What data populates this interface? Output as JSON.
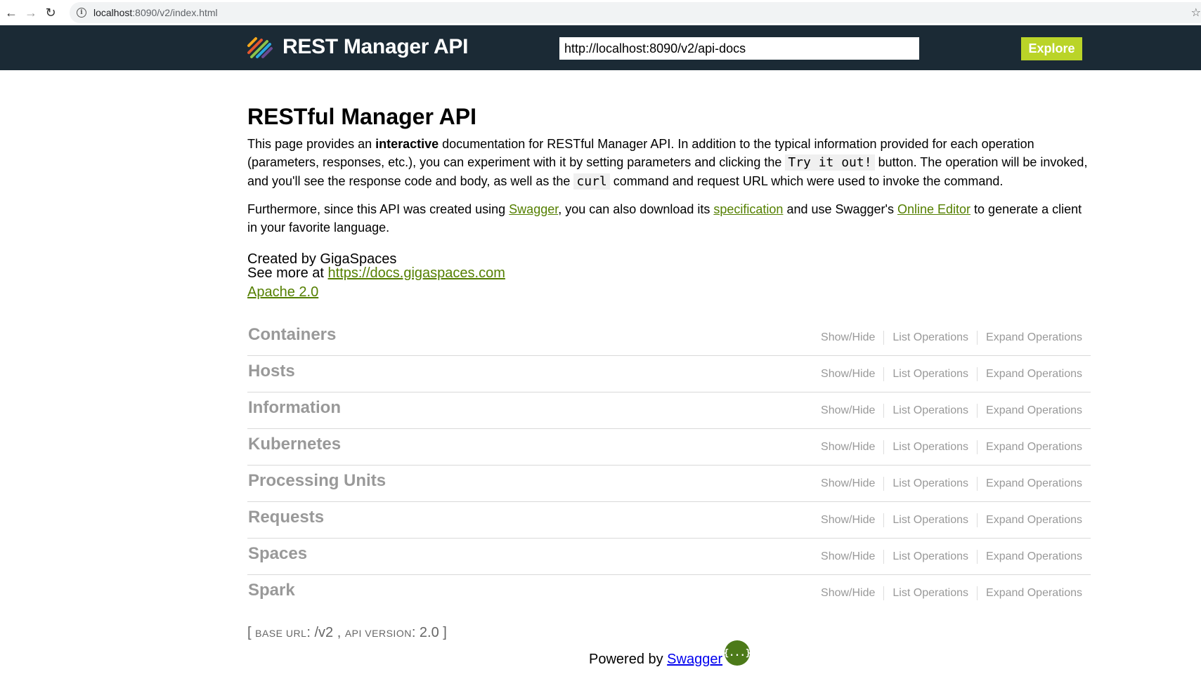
{
  "browser": {
    "url_host": "localhost",
    "url_path": ":8090/v2/index.html"
  },
  "header": {
    "brand": "REST Manager API",
    "spec_url": "http://localhost:8090/v2/api-docs",
    "explore_label": "Explore"
  },
  "info": {
    "title": "RESTful Manager API",
    "p1_a": "This page provides an ",
    "p1_b": "interactive",
    "p1_c": " documentation for RESTful Manager API. In addition to the typical information provided for each operation (parameters, responses, etc.), you can experiment with it by setting parameters and clicking the ",
    "p1_code1": "Try it out!",
    "p1_d": " button. The operation will be invoked, and you'll see the response code and body, as well as the ",
    "p1_code2": "curl",
    "p1_e": " command and request URL which were used to invoke the command.",
    "p2_a": "Furthermore, since this API was created using ",
    "p2_link1": "Swagger",
    "p2_b": ", you can also download its ",
    "p2_link2": "specification",
    "p2_c": " and use Swagger's ",
    "p2_link3": "Online Editor",
    "p2_d": " to generate a client in your favorite language.",
    "created": "Created by GigaSpaces",
    "see_more": "See more at ",
    "see_more_link": "https://docs.gigaspaces.com",
    "license": "Apache 2.0"
  },
  "resources": [
    {
      "name": "Containers"
    },
    {
      "name": "Hosts"
    },
    {
      "name": "Information"
    },
    {
      "name": "Kubernetes"
    },
    {
      "name": "Processing Units"
    },
    {
      "name": "Requests"
    },
    {
      "name": "Spaces"
    },
    {
      "name": "Spark"
    }
  ],
  "ops": {
    "show_hide": "Show/Hide",
    "list": "List Operations",
    "expand": "Expand Operations"
  },
  "footer": {
    "open": "[ ",
    "base_label": "BASE URL",
    "base_value": ": /v2 , ",
    "version_label": "API VERSION",
    "version_value": ": 2.0 ]",
    "powered": "Powered by ",
    "powered_link": "Swagger",
    "badge": "{...}"
  }
}
